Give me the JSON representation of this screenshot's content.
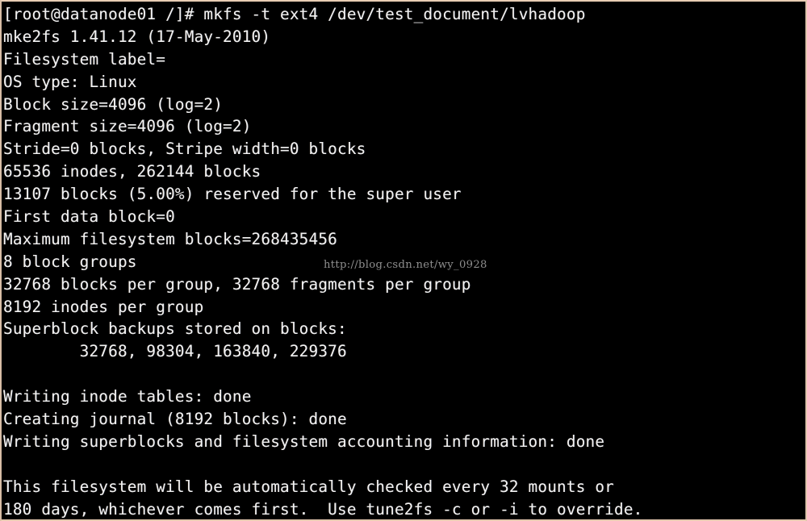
{
  "terminal": {
    "title": "mkfs terminal output",
    "background_color": "#000000",
    "text_color": "#f2f2f2",
    "border_color": "#e8cdb4",
    "prompt": "[root@datanode01 /]#",
    "command": "mkfs -t ext4 /dev/test_document/lvhadoop",
    "lines": [
      "[root@datanode01 /]# mkfs -t ext4 /dev/test_document/lvhadoop",
      "mke2fs 1.41.12 (17-May-2010)",
      "Filesystem label=",
      "OS type: Linux",
      "Block size=4096 (log=2)",
      "Fragment size=4096 (log=2)",
      "Stride=0 blocks, Stripe width=0 blocks",
      "65536 inodes, 262144 blocks",
      "13107 blocks (5.00%) reserved for the super user",
      "First data block=0",
      "Maximum filesystem blocks=268435456",
      "8 block groups",
      "32768 blocks per group, 32768 fragments per group",
      "8192 inodes per group",
      "Superblock backups stored on blocks:",
      "        32768, 98304, 163840, 229376",
      "",
      "Writing inode tables: done",
      "Creating journal (8192 blocks): done",
      "Writing superblocks and filesystem accounting information: done",
      "",
      "This filesystem will be automatically checked every 32 mounts or",
      "180 days, whichever comes first.  Use tune2fs -c or -i to override."
    ]
  },
  "watermark": {
    "text": "http://blog.csdn.net/wy_0928",
    "color": "#8e8e8e"
  }
}
